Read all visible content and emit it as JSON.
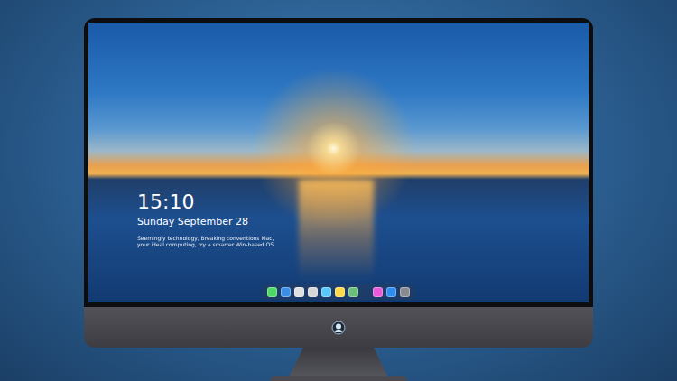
{
  "lock_screen": {
    "time": "15:10",
    "date": "Sunday September 28",
    "note_lines": [
      "Seemingly technology, Breaking conventions Mac,",
      "your ideal computing, try a smarter Win-based OS"
    ]
  },
  "dock": {
    "apps": [
      {
        "color": "#4cd964"
      },
      {
        "color": "#3a8ee6"
      },
      {
        "color": "#e0e0e0"
      },
      {
        "color": "#d8d8d8"
      },
      {
        "color": "#5ac8fa"
      },
      {
        "color": "#ffd84a"
      },
      {
        "color": "#6bbf7a"
      },
      {
        "color": "#e85ad8"
      },
      {
        "color": "#2f8cf0"
      },
      {
        "color": "#8a8a90"
      }
    ]
  }
}
